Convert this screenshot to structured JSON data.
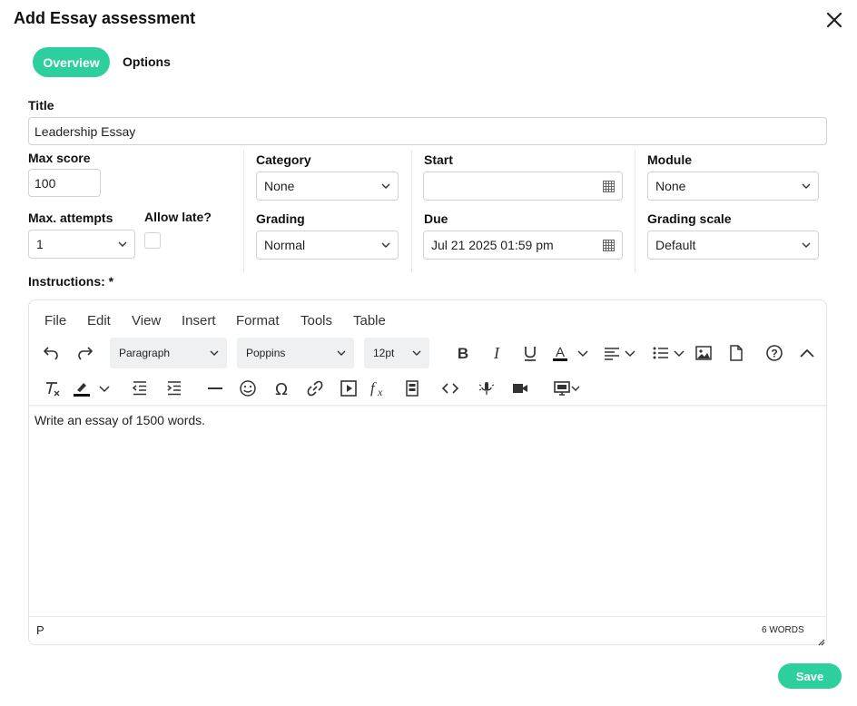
{
  "dialog": {
    "title": "Add Essay assessment",
    "close_icon": "close-icon"
  },
  "tabs": [
    {
      "label": "Overview",
      "active": true
    },
    {
      "label": "Options",
      "active": false
    }
  ],
  "form": {
    "title_label": "Title",
    "title_value": "Leadership Essay",
    "max_score_label": "Max score",
    "max_score_value": "100",
    "max_attempts_label": "Max. attempts",
    "max_attempts_value": "1",
    "allow_late_label": "Allow late?",
    "allow_late_checked": false,
    "category_label": "Category",
    "category_value": "None",
    "grading_label": "Grading",
    "grading_value": "Normal",
    "start_label": "Start",
    "start_value": "",
    "due_label": "Due",
    "due_value": "Jul 21 2025 01:59 pm",
    "module_label": "Module",
    "module_value": "None",
    "grading_scale_label": "Grading scale",
    "grading_scale_value": "Default",
    "instructions_label": "Instructions: *"
  },
  "editor": {
    "menu": [
      "File",
      "Edit",
      "View",
      "Insert",
      "Format",
      "Tools",
      "Table"
    ],
    "block_format": "Paragraph",
    "font_family": "Poppins",
    "font_size": "12pt",
    "content": "Write an essay of 1500 words.",
    "status_element": "P",
    "word_count": "6 WORDS"
  },
  "actions": {
    "save_label": "Save"
  },
  "colors": {
    "accent": "#2ecf9e",
    "border": "#cfd3d8",
    "toolbar_select_bg": "#eef0f2"
  }
}
